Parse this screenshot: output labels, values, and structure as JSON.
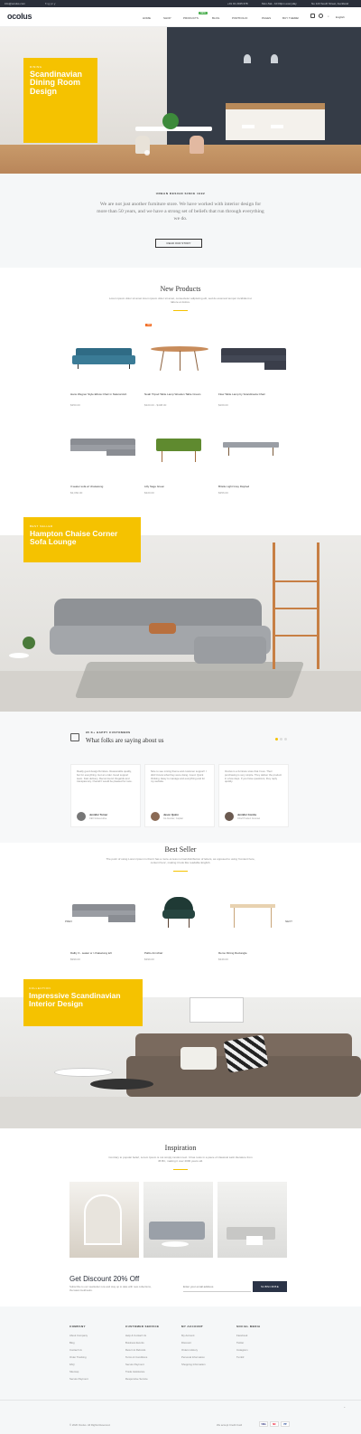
{
  "topbar": {
    "email": "info@ocolus.com",
    "phone": "+01 01 2345 678",
    "hours": "Mon-Sat - 10:00pm everyday",
    "address": "No 123 South Street, Auckland"
  },
  "header": {
    "logo": "ocolus",
    "nav": [
      "Home",
      "Shop",
      "Products",
      "Blog",
      "Portfolio",
      "Pages",
      "Buy Theme!"
    ],
    "nav_badge": "NEW",
    "language": "English"
  },
  "hero": {
    "kicker": "Dining",
    "title": "Scandinavian Dining Room Design"
  },
  "about": {
    "kicker": "URBAN DESIGN SINCE 1992",
    "text": "We are not just another furniture store. We have worked with interior design for more than 50 years, and we have a strong set of beliefs that run through everything we do.",
    "button": "READ OUR STORY"
  },
  "new_products": {
    "title": "New Products",
    "subtitle": "Lorem ipsum dolor sit amet lorem ipsum dolor sit amet, consectetur adipiscing elit, sed do eiusmod tempor incididunt ut labore et dolore.",
    "sale_badge": "-9%",
    "items": [
      {
        "name": "Hans Wegner Style Elbow Chair in Natural Ash",
        "price": "$350.00"
      },
      {
        "name": "Noah Tripod Table Lamp Wooden Table Cream",
        "price": "$320.00 - $408.00"
      },
      {
        "name": "Flow Table Lamp by Scandinavia Chair",
        "price": "$269.00"
      },
      {
        "name": "3 seater sofa w/ chaiselong",
        "price": "$3,060.00"
      },
      {
        "name": "Lilly Sage Green",
        "price": "$320.00"
      },
      {
        "name": "Bristle Light Grey Daybed",
        "price": "$356.00"
      }
    ]
  },
  "banner2": {
    "kicker": "Best Seller",
    "title": "Hampton Chaise Corner Sofa Lounge"
  },
  "testimonials": {
    "kicker": "95 K+ HAPPY CUSTOMERS",
    "title": "What folks are saying about us",
    "items": [
      {
        "text": "Really good design/furniture. Reasonable quality, but for everything. Got an order. Good support team. Fast delivery. Recommend. Regards and transparency. Overall I would be pleased for sure.",
        "name": "Jennifer Turner",
        "role": "CEO & Executive"
      },
      {
        "text": "Nice to see mixing theme and customer support! I didn't know what they were doing. Good. Quick thinking. Easy to manage and everything and for my website.",
        "name": "Jason Quinn",
        "role": "Co-founder, Capital"
      },
      {
        "text": "Ocolus is a furniture store that I love. Their purchasing is very simple. They deliver the product in a few days. If you have questions, they reply quickly.",
        "name": "Jennifer Combs",
        "role": "Chief Product Counsel"
      }
    ]
  },
  "best_seller": {
    "title": "Best Seller",
    "subtitle": "The point of using Lorem Ipsum is that it has a more-or-less normal distribution of letters, as opposed to using 'Content here, content here', making it look like readable English.",
    "prev": "PREV",
    "next": "NEXT",
    "items": [
      {
        "name": "Dalby 3 - seater w / chaiselong left",
        "price": "$999.00"
      },
      {
        "name": "Pablo Armchair",
        "price": "$399.00"
      },
      {
        "name": "Remo Dining Rectangle",
        "price": "$349.00"
      }
    ]
  },
  "banner3": {
    "kicker": "Collection",
    "title": "Impressive Scandinavian Interior Design"
  },
  "inspiration": {
    "title": "Inspiration",
    "subtitle": "Contrary to popular belief, Lorem Ipsum is not simply random text. It has roots in a piece of classical Latin literature from 45 BC, making it over 2000 years old."
  },
  "newsletter": {
    "title": "Get Discount 20% Off",
    "text": "Subscribe to our newsletter now and stay up to date with new collections, the latest lookbooks.",
    "placeholder": "Enter your email address",
    "button": "SUBSCRIBE"
  },
  "footer": {
    "columns": [
      {
        "title": "COMPANY",
        "items": [
          "About Company",
          "Blog",
          "Contact Us",
          "Order Tracking",
          "FAQ",
          "Sitemap",
          "Secure Payment"
        ]
      },
      {
        "title": "CUSTOMER SERVICE",
        "items": [
          "Help & Contact Us",
          "Business Events",
          "Return & Refunds",
          "Terms & Conditions",
          "Secure Payment",
          "Trade Assistance",
          "Responsive Service"
        ]
      },
      {
        "title": "MY ACCOUNT",
        "items": [
          "My Account",
          "Discount",
          "Orders History",
          "Personal Information",
          "Shopping Information"
        ]
      },
      {
        "title": "SOCIAL MEDIA",
        "items": [
          "Facebook",
          "Twitter",
          "Instagram",
          "Tumblr"
        ]
      }
    ],
    "copyright": "© 2020 Ocolus. All Rights Reserved.",
    "payment_label": "We accept Credit Card",
    "payments": [
      "VISA",
      "MC",
      "PP"
    ]
  },
  "colors": {
    "accent": "#f5c200",
    "dark": "#2a2f3a",
    "button": "#2a3346"
  }
}
